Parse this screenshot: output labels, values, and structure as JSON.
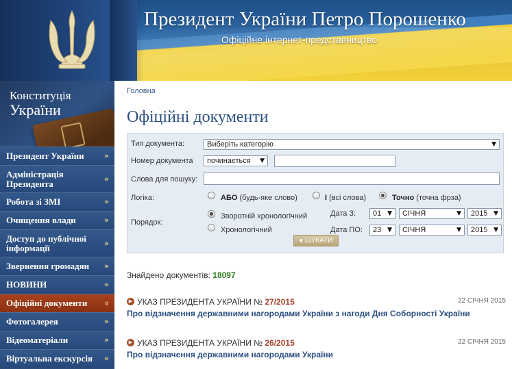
{
  "header": {
    "title": "Президент України Петро Порошенко",
    "subtitle": "Офіційне інтернет-представництво"
  },
  "sidebar": {
    "constitution": {
      "line1": "Конституція",
      "line2": "України"
    },
    "items": [
      {
        "label": "Президент України",
        "active": false
      },
      {
        "label": "Адміністрація Президента",
        "active": false
      },
      {
        "label": "Робота зі ЗМІ",
        "active": false
      },
      {
        "label": "Очищення влади",
        "active": false
      },
      {
        "label": "Доступ до публічної інформації",
        "active": false
      },
      {
        "label": "Звернення громадян",
        "active": false
      },
      {
        "label": "НОВИНИ",
        "active": false
      },
      {
        "label": "Офіційні документи",
        "active": true
      },
      {
        "label": "Фотогалерея",
        "active": false
      },
      {
        "label": "Відеоматеріали",
        "active": false
      },
      {
        "label": "Віртуальна екскурсія",
        "active": false
      }
    ]
  },
  "breadcrumb": "Головна",
  "page_title": "Офіційні документи",
  "search": {
    "doc_type_label": "Тип документа:",
    "doc_type_value": "Виберіть категорію",
    "doc_number_label": "Номер документа",
    "doc_number_mode": "починається",
    "doc_number_value": "",
    "words_label": "Слова для пошуку:",
    "words_value": "",
    "logic_label": "Логіка:",
    "logic_options": [
      {
        "bold": "АБО",
        "rest": "(будь-яке слово)",
        "checked": false
      },
      {
        "bold": "І",
        "rest": "(всі слова)",
        "checked": false
      },
      {
        "bold": "Точно",
        "rest": "(точна фрза)",
        "checked": true
      }
    ],
    "order_label": "Порядок:",
    "order_options": [
      {
        "label": "Зворотній хронологічний",
        "checked": true
      },
      {
        "label": "Хронологічний",
        "checked": false
      }
    ],
    "date_from_label": "Дата З:",
    "date_from": {
      "day": "01",
      "month": "СІЧНЯ",
      "year": "2015"
    },
    "date_to_label": "Дата ПО:",
    "date_to": {
      "day": "23",
      "month": "СІЧНЯ",
      "year": "2015"
    },
    "button_label": "ШУКАТИ"
  },
  "results": {
    "found_label": "Знайдено документів:",
    "found_count": "18097",
    "documents": [
      {
        "type": "УКАЗ ПРЕЗИДЕНТА УКРАЇНИ №",
        "number": "27/2015",
        "date": "22 СІЧНЯ 2015",
        "title": "Про відзначення державними нагородами України з нагоди Дня Соборності України"
      },
      {
        "type": "УКАЗ ПРЕЗИДЕНТА УКРАЇНИ №",
        "number": "26/2015",
        "date": "22 СІЧНЯ 2015",
        "title": "Про відзначення державними нагородами України"
      }
    ]
  },
  "colors": {
    "nav_blue": "#2d4d7a",
    "nav_active": "#a8411c",
    "title_blue": "#2b4f82",
    "count_green": "#2f7a20"
  }
}
